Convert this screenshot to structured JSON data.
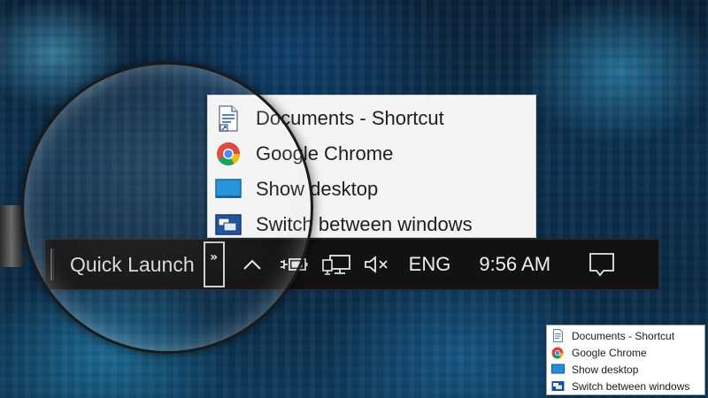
{
  "jump_menu": {
    "items": [
      {
        "label": "Documents - Shortcut",
        "icon": "document-shortcut-icon"
      },
      {
        "label": "Google Chrome",
        "icon": "chrome-icon"
      },
      {
        "label": "Show desktop",
        "icon": "show-desktop-icon"
      },
      {
        "label": "Switch between windows",
        "icon": "switch-windows-icon"
      }
    ]
  },
  "taskbar": {
    "toolbar_label": "Quick Launch",
    "overflow_glyph": "»",
    "tray_expand_glyph": "∧",
    "language": "ENG",
    "clock": "9:56 AM"
  },
  "mini_menu": {
    "items": [
      {
        "label": "Documents - Shortcut",
        "icon": "document-shortcut-icon"
      },
      {
        "label": "Google Chrome",
        "icon": "chrome-icon"
      },
      {
        "label": "Show desktop",
        "icon": "show-desktop-icon"
      },
      {
        "label": "Switch between windows",
        "icon": "switch-windows-icon"
      }
    ]
  },
  "colors": {
    "taskbar_bg": "#121212",
    "menu_bg": "#f4f4f4",
    "desktop_blue": "#1e90d8"
  }
}
